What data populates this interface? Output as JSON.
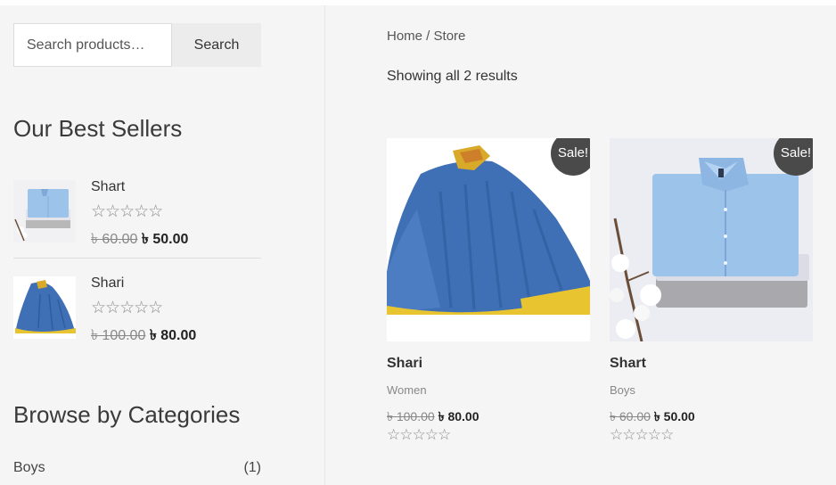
{
  "search": {
    "placeholder": "Search products…",
    "button_label": "Search"
  },
  "best_sellers": {
    "title": "Our Best Sellers",
    "items": [
      {
        "name": "Shart",
        "stars": "☆☆☆☆☆",
        "old_price": "৳ 60.00",
        "new_price": "৳ 50.00"
      },
      {
        "name": "Shari",
        "stars": "☆☆☆☆☆",
        "old_price": "৳ 100.00",
        "new_price": "৳ 80.00"
      }
    ]
  },
  "categories_widget": {
    "title": "Browse by Categories",
    "items": [
      {
        "label": "Boys",
        "count": "(1)"
      }
    ]
  },
  "breadcrumb": {
    "home": "Home",
    "separator": " / ",
    "current": "Store"
  },
  "result_count": "Showing all 2 results",
  "products": [
    {
      "badge": "Sale!",
      "title": "Shari",
      "category": "Women",
      "old_price": "৳ 100.00",
      "new_price": "৳ 80.00",
      "stars": "☆☆☆☆☆"
    },
    {
      "badge": "Sale!",
      "title": "Shart",
      "category": "Boys",
      "old_price": "৳ 60.00",
      "new_price": "৳ 50.00",
      "stars": "☆☆☆☆☆"
    }
  ],
  "colors": {
    "badge": "#4a4a4a",
    "saree_blue": "#3f6fb5",
    "saree_border": "#e8c430",
    "shirt_blue": "#9cc3ea"
  },
  "icons": {
    "rating": "star-outline-icon"
  }
}
